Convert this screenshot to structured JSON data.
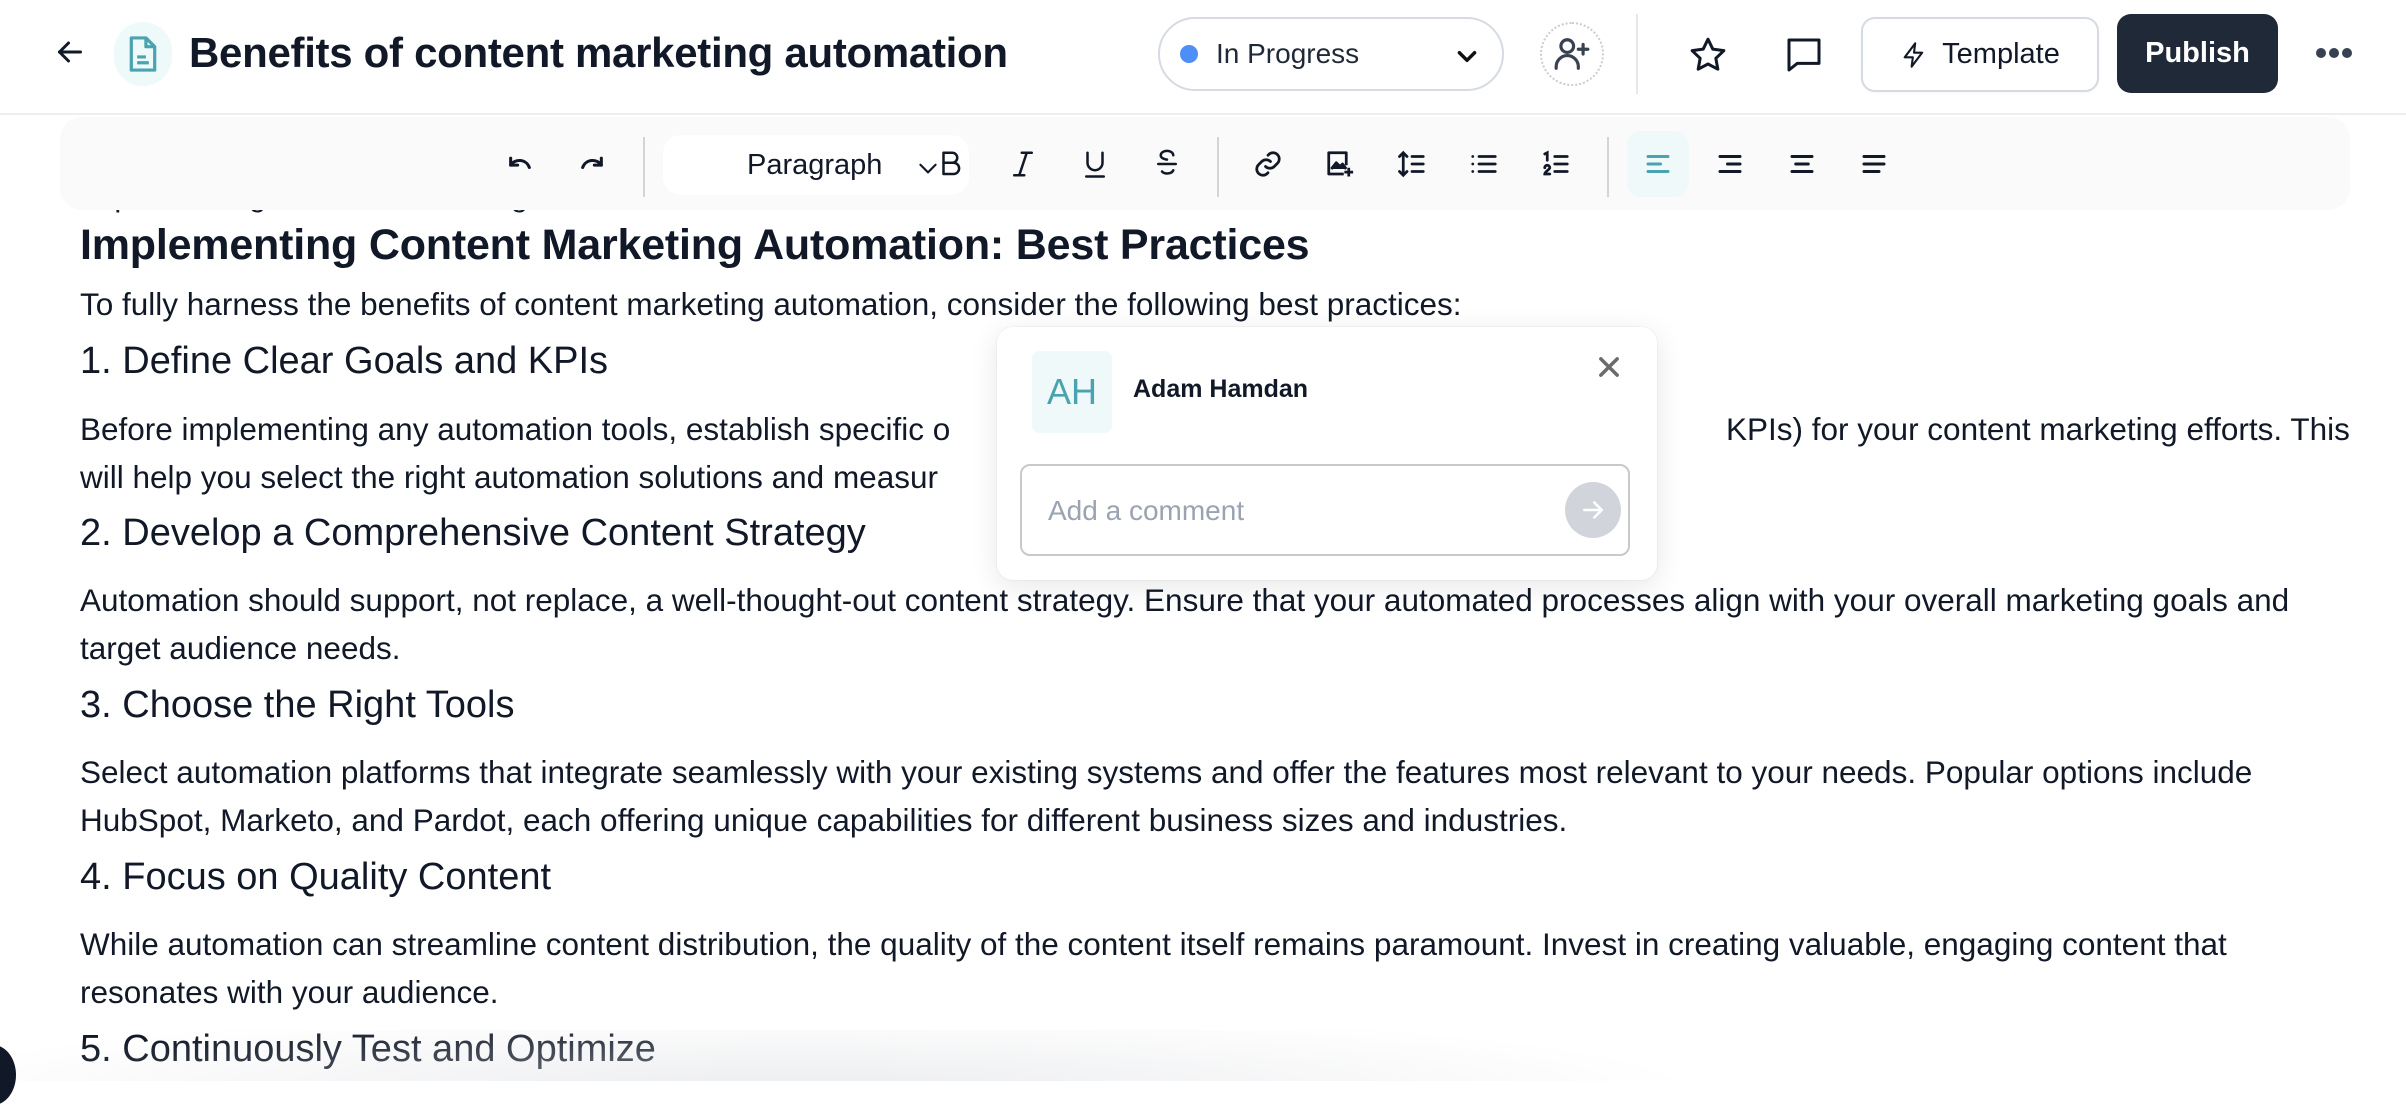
{
  "header": {
    "title": "Benefits of content marketing automation",
    "back_icon": "arrow-left-icon",
    "doc_icon": "document-icon",
    "status": {
      "label": "In Progress",
      "dot_color": "#4f8ef7"
    },
    "add_collaborator_icon": "user-plus-icon",
    "star_icon": "star-icon",
    "comment_icon": "comment-icon",
    "template_label": "Template",
    "template_icon": "lightning-icon",
    "publish_label": "Publish",
    "more_icon": "more-horizontal-icon"
  },
  "toolbar": {
    "undo_icon": "undo-icon",
    "redo_icon": "redo-icon",
    "block_type": "Paragraph",
    "formatting": [
      "bold-icon",
      "italic-icon",
      "underline-icon",
      "strikethrough-icon"
    ],
    "insert": [
      "link-icon",
      "image-add-icon",
      "line-height-icon",
      "bullet-list-icon",
      "numbered-list-icon"
    ],
    "alignment": [
      "align-left-icon",
      "align-right-icon",
      "align-center-icon",
      "align-justify-icon"
    ],
    "active_alignment": "align-left",
    "accent_color": "#4aa3b0"
  },
  "document": {
    "cut_off_line": "Implementing Content Marketing Automation: Best Practices",
    "heading": "Implementing Content Marketing Automation: Best Practices",
    "intro": "To fully harness the benefits of content marketing automation, consider the following best practices:",
    "sections": [
      {
        "title": "1. Define Clear Goals and KPIs",
        "body_line1_left": "Before implementing any automation tools, establish specific o",
        "body_line1_right": "KPIs) for your content marketing efforts. This",
        "body_line2": "will help you select the right automation solutions and measur"
      },
      {
        "title": "2. Develop a Comprehensive Content Strategy",
        "body": "Automation should support, not replace, a well-thought-out content strategy. Ensure that your automated processes align with your overall marketing goals and target audience needs."
      },
      {
        "title": "3. Choose the Right Tools",
        "body": "Select automation platforms that integrate seamlessly with your existing systems and offer the features most relevant to your needs. Popular options include HubSpot, Marketo, and Pardot, each offering unique capabilities for different business sizes and industries."
      },
      {
        "title": "4. Focus on Quality Content",
        "body": "While automation can streamline content distribution, the quality of the content itself remains paramount. Invest in creating valuable, engaging content that resonates with your audience."
      },
      {
        "title": "5. Continuously Test and Optimize"
      }
    ]
  },
  "comment_popup": {
    "avatar_initials": "AH",
    "user_name": "Adam Hamdan",
    "close_icon": "close-icon",
    "input_placeholder": "Add a comment",
    "input_value": "",
    "send_icon": "arrow-right-icon"
  }
}
